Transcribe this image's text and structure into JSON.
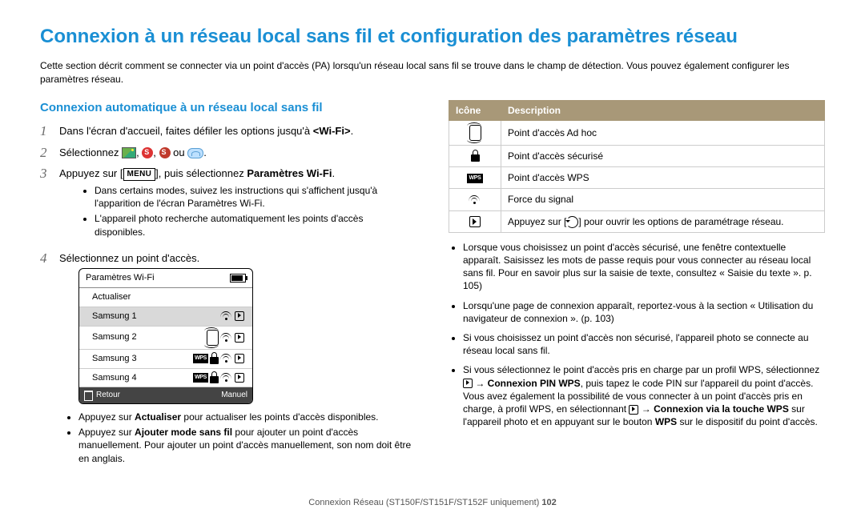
{
  "title": "Connexion à un réseau local sans fil et configuration des paramètres réseau",
  "intro": "Cette section décrit comment se connecter via un point d'accès (PA) lorsqu'un réseau local sans fil se trouve dans le champ de détection. Vous pouvez également configurer les paramètres réseau.",
  "left": {
    "subtitle": "Connexion automatique à un réseau local sans fil",
    "step1_a": "Dans l'écran d'accueil, faites défiler les options jusqu'à ",
    "step1_b": "<Wi-Fi>",
    "step1_c": ".",
    "step2_a": "Sélectionnez ",
    "step2_b": ", ",
    "step2_c": ", ",
    "step2_d": " ou ",
    "step2_e": ".",
    "step3_a": "Appuyez sur [",
    "step3_menu": "MENU",
    "step3_b": "], puis sélectionnez ",
    "step3_c": "Paramètres Wi-Fi",
    "step3_d": ".",
    "step3_sub1": "Dans certains modes, suivez les instructions qui s'affichent jusqu'à l'apparition de l'écran Paramètres Wi-Fi.",
    "step3_sub2": "L'appareil photo recherche automatiquement les points d'accès disponibles.",
    "step4": "Sélectionnez un point d'accès.",
    "device": {
      "title": "Paramètres Wi-Fi",
      "rows": [
        "Actualiser",
        "Samsung 1",
        "Samsung 2",
        "Samsung 3",
        "Samsung 4"
      ],
      "foot_back": "Retour",
      "foot_manual": "Manuel"
    },
    "post_bullet1_a": "Appuyez sur ",
    "post_bullet1_b": "Actualiser",
    "post_bullet1_c": " pour actualiser les points d'accès disponibles.",
    "post_bullet2_a": "Appuyez sur ",
    "post_bullet2_b": "Ajouter mode sans fil",
    "post_bullet2_c": " pour ajouter un point d'accès manuellement. Pour ajouter un point d'accès manuellement, son nom doit être en anglais."
  },
  "right": {
    "th_icon": "Icône",
    "th_desc": "Description",
    "rows": [
      "Point d'accès Ad hoc",
      "Point d'accès sécurisé",
      "Point d'accès WPS",
      "Force du signal"
    ],
    "row5_a": "Appuyez sur [",
    "row5_b": "] pour ouvrir les options de paramétrage réseau.",
    "b1": "Lorsque vous choisissez un point d'accès sécurisé, une fenêtre contextuelle apparaît. Saisissez les mots de passe requis pour vous connecter au réseau local sans fil. Pour en savoir plus sur la saisie de texte, consultez « Saisie du texte ». p. 105)",
    "b2": "Lorsqu'une page de connexion apparaît, reportez-vous à la section « Utilisation du navigateur de connexion ». (p. 103)",
    "b3": "Si vous choisissez un point d'accès non sécurisé, l'appareil photo se connecte au réseau local sans fil.",
    "b4_a": "Si vous sélectionnez le point d'accès pris en charge par un profil WPS, sélectionnez ",
    "b4_b": " → ",
    "b4_c": "Connexion PIN WPS",
    "b4_d": ", puis tapez le code PIN sur l'appareil du point d'accès. Vous avez également la possibilité de vous connecter à un point d'accès pris en charge, à profil WPS, en sélectionnant ",
    "b4_e": " → ",
    "b4_f": "Connexion via la touche WPS",
    "b4_g": " sur l'appareil photo et en appuyant sur le bouton ",
    "b4_h": "WPS",
    "b4_i": " sur le dispositif du point d'accès."
  },
  "footer_a": "Connexion Réseau (ST150F/ST151F/ST152F uniquement)  ",
  "footer_b": "102"
}
